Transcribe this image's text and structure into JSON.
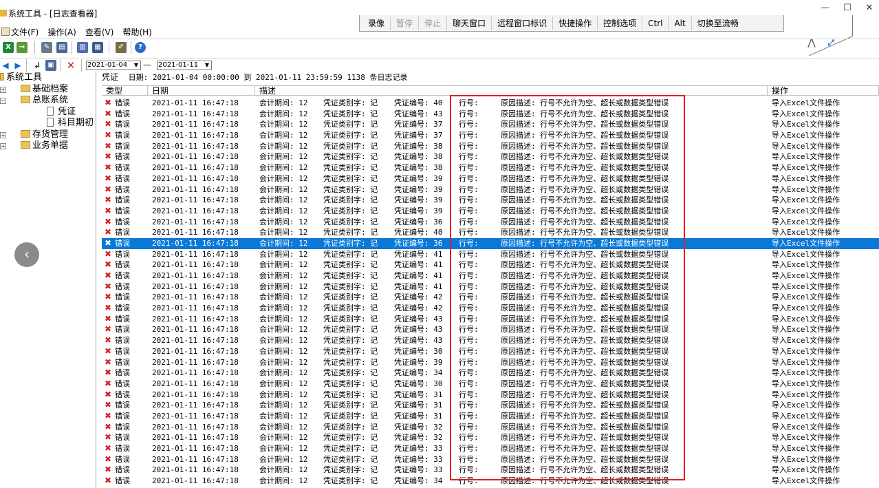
{
  "window": {
    "title": "系统工具 - [日志查看器]",
    "minimize_glyph": "—",
    "maximize_glyph": "☐",
    "close_glyph": "✕"
  },
  "remote_toolbar": {
    "buttons": [
      {
        "label": "录像",
        "enabled": true
      },
      {
        "label": "暂停",
        "enabled": false
      },
      {
        "label": "停止",
        "enabled": false
      },
      {
        "label": "聊天窗口",
        "enabled": true
      },
      {
        "label": "远程窗口标识",
        "enabled": true
      },
      {
        "label": "快捷操作",
        "enabled": true
      },
      {
        "label": "控制选项",
        "enabled": true
      },
      {
        "label": "Ctrl",
        "enabled": true
      },
      {
        "label": "Alt",
        "enabled": true
      },
      {
        "label": "切换至流畅",
        "enabled": true
      }
    ],
    "pin_icon": "pin-icon",
    "fullscreen_icon": "fullscreen-icon"
  },
  "menu": [
    "文件(F)",
    "操作(A)",
    "查看(V)",
    "帮助(H)"
  ],
  "toolbar1_icons": [
    "excel-export-icon",
    "import-icon",
    "tools-icon",
    "print-preview-icon",
    "print-icon",
    "calculator-icon",
    "edit-icon",
    "help-icon"
  ],
  "toolbar2": {
    "icons": [
      "back-icon",
      "forward-icon",
      "refresh-icon",
      "save-icon",
      "delete-icon"
    ],
    "date_from": "2021-01-04",
    "date_to": "2021-01-11",
    "dash": "—"
  },
  "tree": {
    "root": "系统工具",
    "nodes": [
      {
        "label": "基础档案",
        "level": 1,
        "expandable": true
      },
      {
        "label": "总账系统",
        "level": 1,
        "expandable": true
      },
      {
        "label": "凭证",
        "level": 2,
        "expandable": false
      },
      {
        "label": "科目期初",
        "level": 2,
        "expandable": false
      },
      {
        "label": "存货管理",
        "level": 1,
        "expandable": true
      },
      {
        "label": "业务单据",
        "level": 1,
        "expandable": true
      }
    ]
  },
  "grid": {
    "caption_label": "凭证",
    "caption_text": "日期: 2021-01-04 00:00:00 到 2021-01-11 23:59:59  1138 条日志记录",
    "columns": [
      "类型",
      "日期",
      "描述",
      "操作"
    ],
    "selected_index": 13,
    "rows": [
      {
        "type": "错误",
        "date": "2021-01-11 16:47:18",
        "period": "会计期间: 12",
        "cls": "凭证类别字: 记",
        "no": "凭证编号: 40",
        "line": "行号:",
        "reason": "原因描述: 行号不允许为空、超长或数据类型错误",
        "op": "导入Excel文件操作"
      },
      {
        "type": "错误",
        "date": "2021-01-11 16:47:18",
        "period": "会计期间: 12",
        "cls": "凭证类别字: 记",
        "no": "凭证编号: 43",
        "line": "行号:",
        "reason": "原因描述: 行号不允许为空、超长或数据类型错误",
        "op": "导入Excel文件操作"
      },
      {
        "type": "错误",
        "date": "2021-01-11 16:47:18",
        "period": "会计期间: 12",
        "cls": "凭证类别字: 记",
        "no": "凭证编号: 37",
        "line": "行号:",
        "reason": "原因描述: 行号不允许为空、超长或数据类型错误",
        "op": "导入Excel文件操作"
      },
      {
        "type": "错误",
        "date": "2021-01-11 16:47:18",
        "period": "会计期间: 12",
        "cls": "凭证类别字: 记",
        "no": "凭证编号: 37",
        "line": "行号:",
        "reason": "原因描述: 行号不允许为空、超长或数据类型错误",
        "op": "导入Excel文件操作"
      },
      {
        "type": "错误",
        "date": "2021-01-11 16:47:18",
        "period": "会计期间: 12",
        "cls": "凭证类别字: 记",
        "no": "凭证编号: 38",
        "line": "行号:",
        "reason": "原因描述: 行号不允许为空、超长或数据类型错误",
        "op": "导入Excel文件操作"
      },
      {
        "type": "错误",
        "date": "2021-01-11 16:47:18",
        "period": "会计期间: 12",
        "cls": "凭证类别字: 记",
        "no": "凭证编号: 38",
        "line": "行号:",
        "reason": "原因描述: 行号不允许为空、超长或数据类型错误",
        "op": "导入Excel文件操作"
      },
      {
        "type": "错误",
        "date": "2021-01-11 16:47:18",
        "period": "会计期间: 12",
        "cls": "凭证类别字: 记",
        "no": "凭证编号: 38",
        "line": "行号:",
        "reason": "原因描述: 行号不允许为空、超长或数据类型错误",
        "op": "导入Excel文件操作"
      },
      {
        "type": "错误",
        "date": "2021-01-11 16:47:18",
        "period": "会计期间: 12",
        "cls": "凭证类别字: 记",
        "no": "凭证编号: 39",
        "line": "行号:",
        "reason": "原因描述: 行号不允许为空、超长或数据类型错误",
        "op": "导入Excel文件操作"
      },
      {
        "type": "错误",
        "date": "2021-01-11 16:47:18",
        "period": "会计期间: 12",
        "cls": "凭证类别字: 记",
        "no": "凭证编号: 39",
        "line": "行号:",
        "reason": "原因描述: 行号不允许为空、超长或数据类型错误",
        "op": "导入Excel文件操作"
      },
      {
        "type": "错误",
        "date": "2021-01-11 16:47:18",
        "period": "会计期间: 12",
        "cls": "凭证类别字: 记",
        "no": "凭证编号: 39",
        "line": "行号:",
        "reason": "原因描述: 行号不允许为空、超长或数据类型错误",
        "op": "导入Excel文件操作"
      },
      {
        "type": "错误",
        "date": "2021-01-11 16:47:18",
        "period": "会计期间: 12",
        "cls": "凭证类别字: 记",
        "no": "凭证编号: 39",
        "line": "行号:",
        "reason": "原因描述: 行号不允许为空、超长或数据类型错误",
        "op": "导入Excel文件操作"
      },
      {
        "type": "错误",
        "date": "2021-01-11 16:47:18",
        "period": "会计期间: 12",
        "cls": "凭证类别字: 记",
        "no": "凭证编号: 36",
        "line": "行号:",
        "reason": "原因描述: 行号不允许为空、超长或数据类型错误",
        "op": "导入Excel文件操作"
      },
      {
        "type": "错误",
        "date": "2021-01-11 16:47:18",
        "period": "会计期间: 12",
        "cls": "凭证类别字: 记",
        "no": "凭证编号: 40",
        "line": "行号:",
        "reason": "原因描述: 行号不允许为空、超长或数据类型错误",
        "op": "导入Excel文件操作"
      },
      {
        "type": "错误",
        "date": "2021-01-11 16:47:18",
        "period": "会计期间: 12",
        "cls": "凭证类别字: 记",
        "no": "凭证编号: 36",
        "line": "行号:",
        "reason": "原因描述: 行号不允许为空、超长或数据类型错误",
        "op": "导入Excel文件操作"
      },
      {
        "type": "错误",
        "date": "2021-01-11 16:47:18",
        "period": "会计期间: 12",
        "cls": "凭证类别字: 记",
        "no": "凭证编号: 41",
        "line": "行号:",
        "reason": "原因描述: 行号不允许为空、超长或数据类型错误",
        "op": "导入Excel文件操作"
      },
      {
        "type": "错误",
        "date": "2021-01-11 16:47:18",
        "period": "会计期间: 12",
        "cls": "凭证类别字: 记",
        "no": "凭证编号: 41",
        "line": "行号:",
        "reason": "原因描述: 行号不允许为空、超长或数据类型错误",
        "op": "导入Excel文件操作"
      },
      {
        "type": "错误",
        "date": "2021-01-11 16:47:18",
        "period": "会计期间: 12",
        "cls": "凭证类别字: 记",
        "no": "凭证编号: 41",
        "line": "行号:",
        "reason": "原因描述: 行号不允许为空、超长或数据类型错误",
        "op": "导入Excel文件操作"
      },
      {
        "type": "错误",
        "date": "2021-01-11 16:47:18",
        "period": "会计期间: 12",
        "cls": "凭证类别字: 记",
        "no": "凭证编号: 41",
        "line": "行号:",
        "reason": "原因描述: 行号不允许为空、超长或数据类型错误",
        "op": "导入Excel文件操作"
      },
      {
        "type": "错误",
        "date": "2021-01-11 16:47:18",
        "period": "会计期间: 12",
        "cls": "凭证类别字: 记",
        "no": "凭证编号: 42",
        "line": "行号:",
        "reason": "原因描述: 行号不允许为空、超长或数据类型错误",
        "op": "导入Excel文件操作"
      },
      {
        "type": "错误",
        "date": "2021-01-11 16:47:18",
        "period": "会计期间: 12",
        "cls": "凭证类别字: 记",
        "no": "凭证编号: 42",
        "line": "行号:",
        "reason": "原因描述: 行号不允许为空、超长或数据类型错误",
        "op": "导入Excel文件操作"
      },
      {
        "type": "错误",
        "date": "2021-01-11 16:47:18",
        "period": "会计期间: 12",
        "cls": "凭证类别字: 记",
        "no": "凭证编号: 43",
        "line": "行号:",
        "reason": "原因描述: 行号不允许为空、超长或数据类型错误",
        "op": "导入Excel文件操作"
      },
      {
        "type": "错误",
        "date": "2021-01-11 16:47:18",
        "period": "会计期间: 12",
        "cls": "凭证类别字: 记",
        "no": "凭证编号: 43",
        "line": "行号:",
        "reason": "原因描述: 行号不允许为空、超长或数据类型错误",
        "op": "导入Excel文件操作"
      },
      {
        "type": "错误",
        "date": "2021-01-11 16:47:18",
        "period": "会计期间: 12",
        "cls": "凭证类别字: 记",
        "no": "凭证编号: 43",
        "line": "行号:",
        "reason": "原因描述: 行号不允许为空、超长或数据类型错误",
        "op": "导入Excel文件操作"
      },
      {
        "type": "错误",
        "date": "2021-01-11 16:47:18",
        "period": "会计期间: 12",
        "cls": "凭证类别字: 记",
        "no": "凭证编号: 30",
        "line": "行号:",
        "reason": "原因描述: 行号不允许为空、超长或数据类型错误",
        "op": "导入Excel文件操作"
      },
      {
        "type": "错误",
        "date": "2021-01-11 16:47:18",
        "period": "会计期间: 12",
        "cls": "凭证类别字: 记",
        "no": "凭证编号: 39",
        "line": "行号:",
        "reason": "原因描述: 行号不允许为空、超长或数据类型错误",
        "op": "导入Excel文件操作"
      },
      {
        "type": "错误",
        "date": "2021-01-11 16:47:18",
        "period": "会计期间: 12",
        "cls": "凭证类别字: 记",
        "no": "凭证编号: 34",
        "line": "行号:",
        "reason": "原因描述: 行号不允许为空、超长或数据类型错误",
        "op": "导入Excel文件操作"
      },
      {
        "type": "错误",
        "date": "2021-01-11 16:47:18",
        "period": "会计期间: 12",
        "cls": "凭证类别字: 记",
        "no": "凭证编号: 30",
        "line": "行号:",
        "reason": "原因描述: 行号不允许为空、超长或数据类型错误",
        "op": "导入Excel文件操作"
      },
      {
        "type": "错误",
        "date": "2021-01-11 16:47:18",
        "period": "会计期间: 12",
        "cls": "凭证类别字: 记",
        "no": "凭证编号: 31",
        "line": "行号:",
        "reason": "原因描述: 行号不允许为空、超长或数据类型错误",
        "op": "导入Excel文件操作"
      },
      {
        "type": "错误",
        "date": "2021-01-11 16:47:18",
        "period": "会计期间: 12",
        "cls": "凭证类别字: 记",
        "no": "凭证编号: 31",
        "line": "行号:",
        "reason": "原因描述: 行号不允许为空、超长或数据类型错误",
        "op": "导入Excel文件操作"
      },
      {
        "type": "错误",
        "date": "2021-01-11 16:47:18",
        "period": "会计期间: 12",
        "cls": "凭证类别字: 记",
        "no": "凭证编号: 31",
        "line": "行号:",
        "reason": "原因描述: 行号不允许为空、超长或数据类型错误",
        "op": "导入Excel文件操作"
      },
      {
        "type": "错误",
        "date": "2021-01-11 16:47:18",
        "period": "会计期间: 12",
        "cls": "凭证类别字: 记",
        "no": "凭证编号: 32",
        "line": "行号:",
        "reason": "原因描述: 行号不允许为空、超长或数据类型错误",
        "op": "导入Excel文件操作"
      },
      {
        "type": "错误",
        "date": "2021-01-11 16:47:18",
        "period": "会计期间: 12",
        "cls": "凭证类别字: 记",
        "no": "凭证编号: 32",
        "line": "行号:",
        "reason": "原因描述: 行号不允许为空、超长或数据类型错误",
        "op": "导入Excel文件操作"
      },
      {
        "type": "错误",
        "date": "2021-01-11 16:47:18",
        "period": "会计期间: 12",
        "cls": "凭证类别字: 记",
        "no": "凭证编号: 33",
        "line": "行号:",
        "reason": "原因描述: 行号不允许为空、超长或数据类型错误",
        "op": "导入Excel文件操作"
      },
      {
        "type": "错误",
        "date": "2021-01-11 16:47:18",
        "period": "会计期间: 12",
        "cls": "凭证类别字: 记",
        "no": "凭证编号: 33",
        "line": "行号:",
        "reason": "原因描述: 行号不允许为空、超长或数据类型错误",
        "op": "导入Excel文件操作"
      },
      {
        "type": "错误",
        "date": "2021-01-11 16:47:18",
        "period": "会计期间: 12",
        "cls": "凭证类别字: 记",
        "no": "凭证编号: 33",
        "line": "行号:",
        "reason": "原因描述: 行号不允许为空、超长或数据类型错误",
        "op": "导入Excel文件操作"
      },
      {
        "type": "错误",
        "date": "2021-01-11 16:47:18",
        "period": "会计期间: 12",
        "cls": "凭证类别字: 记",
        "no": "凭证编号: 34",
        "line": "行号:",
        "reason": "原因描述: 行号不允许为空、超长或数据类型错误",
        "op": "导入Excel文件操作"
      }
    ]
  },
  "colors": {
    "selection": "#0a78d7",
    "error_icon": "#d82020",
    "highlight_box": "#e0201c"
  },
  "overlay": {
    "back_button_glyph": "‹"
  }
}
